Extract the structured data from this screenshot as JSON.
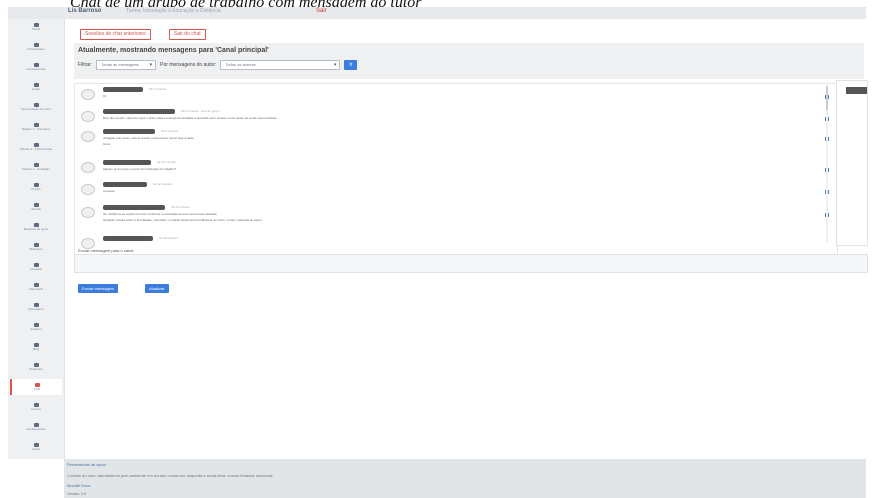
{
  "caption": "Chat de um grupo de trabalho com mensagem do tutor",
  "topbar": {
    "user": "Lis Barroso",
    "subtitle": "Turma: Introdução à Educação a Distância",
    "logout": "Sair"
  },
  "sidebar": {
    "items": [
      {
        "label": "Painel"
      },
      {
        "label": "Participantes"
      },
      {
        "label": "Competências"
      },
      {
        "label": "Notas"
      },
      {
        "label": "Apresentação do curso"
      },
      {
        "label": "Módulo 1 - Conceitos"
      },
      {
        "label": "Módulo 2 - Ferramentas"
      },
      {
        "label": "Módulo 3 - Avaliação"
      },
      {
        "label": "Fóruns"
      },
      {
        "label": "Tarefas"
      },
      {
        "label": "Materiais de apoio"
      },
      {
        "label": "Biblioteca"
      },
      {
        "label": "Glossário"
      },
      {
        "label": "Calendário"
      },
      {
        "label": "Mensagens"
      },
      {
        "label": "Arquivos"
      },
      {
        "label": "Blog"
      },
      {
        "label": "Relatórios"
      },
      {
        "label": "Chat"
      },
      {
        "label": "Grupos"
      },
      {
        "label": "Configurações"
      },
      {
        "label": "Ajuda"
      }
    ]
  },
  "top_buttons": {
    "sessions": "Sessões de chat anteriores",
    "exit": "Sair do chat"
  },
  "panel": {
    "title": "Atualmente, mostrando mensagens para 'Canal principal'",
    "filter_label": "Filtrar:",
    "filter_value": "Todas as mensagens",
    "order_label": "Por mensagens do autor:",
    "order_value": "Todos os autores",
    "go_button": "Ir"
  },
  "messages": [
    {
      "meta": "há 2 minutos",
      "lines": [
        "Oi"
      ]
    },
    {
      "meta": "há 5 minutos - tutor do grupo",
      "lines": [
        "Bom dia a todos, observem que o prazo para a entrega da atividade é amanhã, favor revisar o texto antes de enviar pelo ambiente."
      ]
    },
    {
      "meta": "há 8 minutos",
      "lines": [
        "Obrigado pelo aviso, vamos revisar o documento juntos hoje à tarde.",
        "Certo"
      ]
    },
    {
      "meta": "há 10 minutos",
      "lines": [
        "Alguém já começou a parte da introdução do trabalho?"
      ]
    },
    {
      "meta": "há 12 minutos",
      "lines": [
        "Comecei"
      ]
    },
    {
      "meta": "há 15 minutos",
      "lines": [
        "Ok, dividimos as seções do texto conforme a orientação do tutor na semana passada.",
        "Qualquer dúvida sobre a formatação, consultem o modelo disponível na biblioteca do curso, no item materiais de apoio."
      ]
    },
    {
      "meta": "há 18 minutos",
      "lines": []
    }
  ],
  "reply_label": "Enviar mensagem para o canal",
  "buttons": {
    "send": "Enviar mensagem",
    "refresh": "Atualizar"
  },
  "footer": {
    "line1": "Ferramentas de apoio",
    "line2": "Contato do tutor: atendimento pelo ambiente em horário comercial, segunda a sexta-feira, exceto feriados nacionais",
    "line3": "Moodle Docs",
    "line4": "Versão 3.9"
  }
}
